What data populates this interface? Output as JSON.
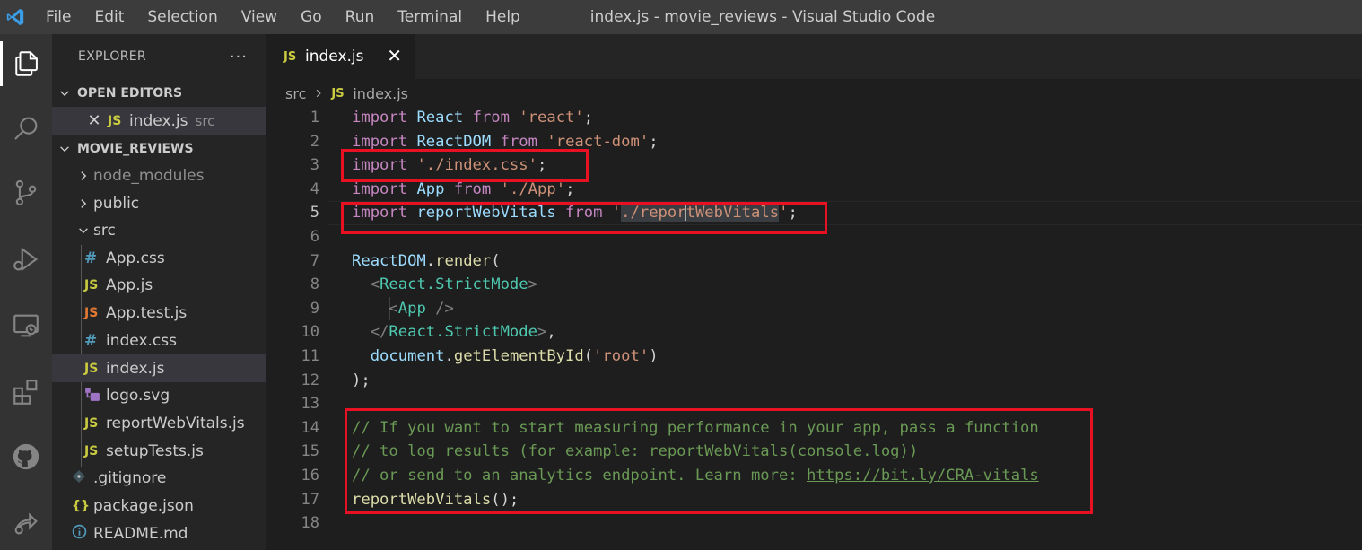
{
  "window": {
    "title": "index.js - movie_reviews - Visual Studio Code",
    "menu": [
      "File",
      "Edit",
      "Selection",
      "View",
      "Go",
      "Run",
      "Terminal",
      "Help"
    ]
  },
  "activity_bar": {
    "icons": [
      "explorer-icon",
      "search-icon",
      "source-control-icon",
      "run-debug-icon",
      "remote-explorer-icon",
      "extensions-icon",
      "github-icon",
      "remote-share-icon"
    ],
    "active": "explorer-icon"
  },
  "sidebar": {
    "title": "EXPLORER",
    "more": "···",
    "open_editors": {
      "label": "OPEN EDITORS",
      "items": [
        {
          "name": "index.js",
          "desc": "src",
          "icon": "JS"
        }
      ]
    },
    "project": {
      "label": "MOVIE_REVIEWS",
      "tree": [
        {
          "name": "node_modules",
          "type": "folder",
          "expanded": false,
          "dim": true
        },
        {
          "name": "public",
          "type": "folder",
          "expanded": false
        },
        {
          "name": "src",
          "type": "folder",
          "expanded": true
        },
        {
          "name": "App.css",
          "type": "css",
          "icon": "#"
        },
        {
          "name": "App.js",
          "type": "js",
          "icon": "JS"
        },
        {
          "name": "App.test.js",
          "type": "test",
          "icon": "JS"
        },
        {
          "name": "index.css",
          "type": "css",
          "icon": "#"
        },
        {
          "name": "index.js",
          "type": "js",
          "icon": "JS",
          "selected": true
        },
        {
          "name": "logo.svg",
          "type": "svg"
        },
        {
          "name": "reportWebVitals.js",
          "type": "js",
          "icon": "JS"
        },
        {
          "name": "setupTests.js",
          "type": "js",
          "icon": "JS"
        },
        {
          "name": ".gitignore",
          "type": "git"
        },
        {
          "name": "package.json",
          "type": "json",
          "icon": "{}"
        },
        {
          "name": "README.md",
          "type": "info"
        }
      ]
    }
  },
  "editor": {
    "tab": {
      "label": "index.js",
      "icon": "JS",
      "close": "✕"
    },
    "breadcrumb": {
      "folder": "src",
      "file": "index.js",
      "icon": "JS"
    },
    "current_line": 5,
    "line_numbers": [
      "1",
      "2",
      "3",
      "4",
      "5",
      "6",
      "7",
      "8",
      "9",
      "10",
      "11",
      "12",
      "13",
      "14",
      "15",
      "16",
      "17",
      "18"
    ],
    "lines": [
      [
        [
          "kw",
          "import"
        ],
        [
          "plain",
          " "
        ],
        [
          "var",
          "React"
        ],
        [
          "plain",
          " "
        ],
        [
          "kw",
          "from"
        ],
        [
          "plain",
          " "
        ],
        [
          "str",
          "'react'"
        ],
        [
          "plain",
          ";"
        ]
      ],
      [
        [
          "kw",
          "import"
        ],
        [
          "plain",
          " "
        ],
        [
          "var",
          "ReactDOM"
        ],
        [
          "plain",
          " "
        ],
        [
          "kw",
          "from"
        ],
        [
          "plain",
          " "
        ],
        [
          "str",
          "'react-dom'"
        ],
        [
          "plain",
          ";"
        ]
      ],
      [
        [
          "kw",
          "import"
        ],
        [
          "plain",
          " "
        ],
        [
          "str",
          "'./index.css'"
        ],
        [
          "plain",
          ";"
        ]
      ],
      [
        [
          "kw",
          "import"
        ],
        [
          "plain",
          " "
        ],
        [
          "var",
          "App"
        ],
        [
          "plain",
          " "
        ],
        [
          "kw",
          "from"
        ],
        [
          "plain",
          " "
        ],
        [
          "str",
          "'./App'"
        ],
        [
          "plain",
          ";"
        ]
      ],
      [
        [
          "kw",
          "import"
        ],
        [
          "plain",
          " "
        ],
        [
          "var",
          "reportWebVitals"
        ],
        [
          "plain",
          " "
        ],
        [
          "kw",
          "from"
        ],
        [
          "plain",
          " "
        ],
        [
          "str",
          "'"
        ],
        [
          "str sel",
          "./repor"
        ],
        [
          "cursor",
          ""
        ],
        [
          "str sel",
          "tWebVitals"
        ],
        [
          "str",
          "'"
        ],
        [
          "plain",
          ";"
        ]
      ],
      [],
      [
        [
          "var",
          "ReactDOM"
        ],
        [
          "plain",
          "."
        ],
        [
          "fn",
          "render"
        ],
        [
          "plain",
          "("
        ]
      ],
      [
        [
          "plain",
          "  "
        ],
        [
          "punc",
          "<"
        ],
        [
          "tag",
          "React.StrictMode"
        ],
        [
          "punc",
          ">"
        ]
      ],
      [
        [
          "plain",
          "    "
        ],
        [
          "punc",
          "<"
        ],
        [
          "tag",
          "App"
        ],
        [
          "plain",
          " "
        ],
        [
          "punc",
          "/>"
        ]
      ],
      [
        [
          "plain",
          "  "
        ],
        [
          "punc",
          "</"
        ],
        [
          "tag",
          "React.StrictMode"
        ],
        [
          "punc",
          ">"
        ],
        [
          "plain",
          ","
        ]
      ],
      [
        [
          "plain",
          "  "
        ],
        [
          "var",
          "document"
        ],
        [
          "plain",
          "."
        ],
        [
          "fn",
          "getElementById"
        ],
        [
          "plain",
          "("
        ],
        [
          "str",
          "'root'"
        ],
        [
          "plain",
          ")"
        ]
      ],
      [
        [
          "plain",
          ");"
        ]
      ],
      [],
      [
        [
          "cmt",
          "// If you want to start measuring performance in your app, pass a function"
        ]
      ],
      [
        [
          "cmt",
          "// to log results (for example: reportWebVitals(console.log))"
        ]
      ],
      [
        [
          "cmt",
          "// or send to an analytics endpoint. Learn more: "
        ],
        [
          "cmt link",
          "https://bit.ly/CRA-vitals"
        ]
      ],
      [
        [
          "fn",
          "reportWebVitals"
        ],
        [
          "plain",
          "();"
        ]
      ],
      []
    ]
  },
  "colors": {
    "annotation": "#e81123",
    "keyword": "#c586c0",
    "variable": "#9cdcfe",
    "string": "#ce9178",
    "function": "#dcdcaa",
    "tag": "#4ec9b0",
    "comment": "#6a9955"
  }
}
